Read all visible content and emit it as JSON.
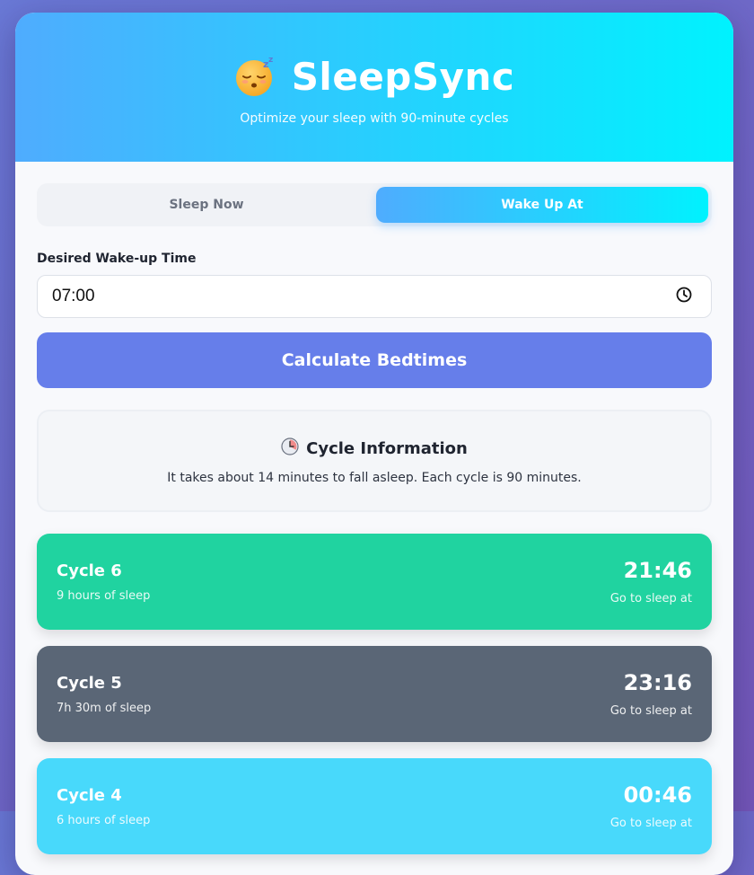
{
  "header": {
    "title": "SleepSync",
    "tagline": "Optimize your sleep with 90-minute cycles",
    "icon": "sleeping-face-icon"
  },
  "tabs": [
    {
      "label": "Sleep Now",
      "active": false
    },
    {
      "label": "Wake Up At",
      "active": true
    }
  ],
  "form": {
    "label": "Desired Wake-up Time",
    "time_value": "07:00",
    "clock_icon": "clock-icon"
  },
  "calculate_button": "Calculate Bedtimes",
  "info": {
    "title": "Cycle Information",
    "text": "It takes about 14 minutes to fall asleep. Each cycle is 90 minutes.",
    "icon": "clock-face-icon"
  },
  "cycles": [
    {
      "name": "Cycle 6",
      "duration": "9 hours of sleep",
      "time": "21:46",
      "note": "Go to sleep at",
      "color": "#20d3a0"
    },
    {
      "name": "Cycle 5",
      "duration": "7h 30m of sleep",
      "time": "23:16",
      "note": "Go to sleep at",
      "color": "#5a6676"
    },
    {
      "name": "Cycle 4",
      "duration": "6 hours of sleep",
      "time": "00:46",
      "note": "Go to sleep at",
      "color": "#48d9fb"
    }
  ],
  "colors": {
    "accent_gradient_start": "#4facfe",
    "accent_gradient_end": "#00f2fe",
    "button": "#667eea",
    "background": "#f8f9fc"
  }
}
